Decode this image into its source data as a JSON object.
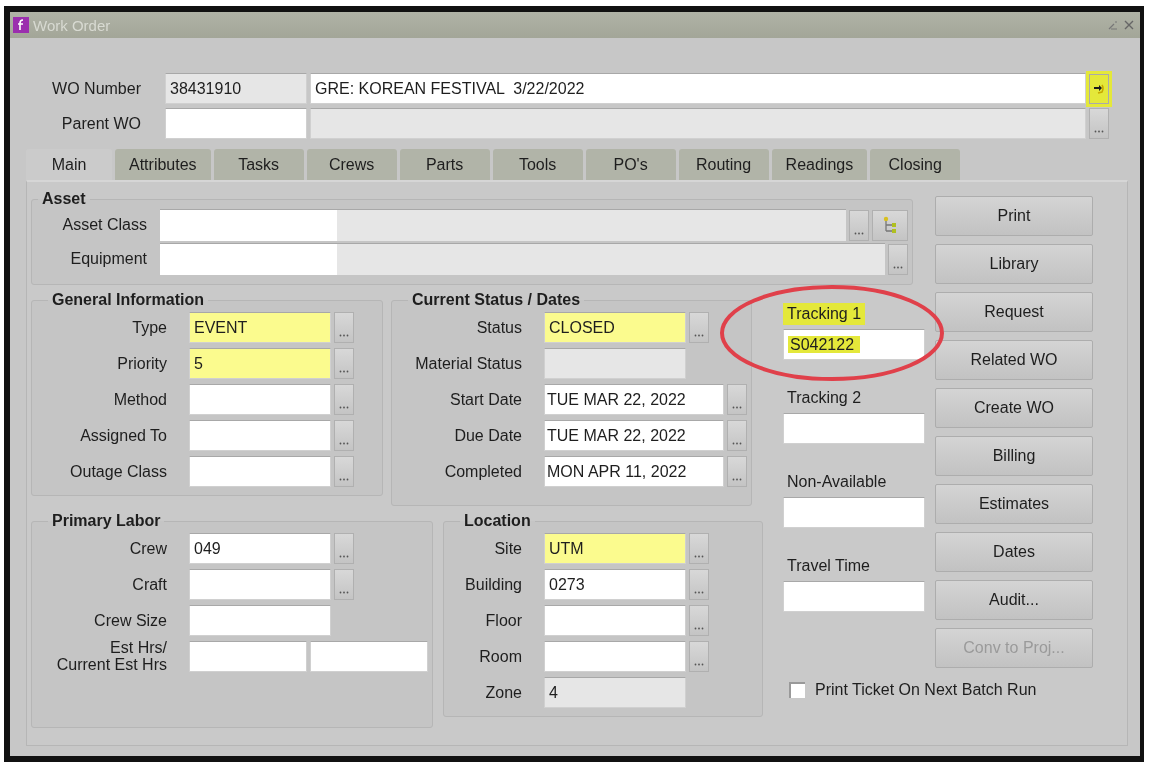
{
  "window": {
    "title": "Work Order"
  },
  "header": {
    "rows": [
      {
        "label": "WO Number",
        "value": "38431910",
        "description": "GRE: KOREAN FESTIVAL  3/22/2022",
        "kind": "go"
      },
      {
        "label": "Parent WO",
        "kind": "lookup"
      }
    ],
    "go_highlighted": true
  },
  "tabs": [
    {
      "label": "Main",
      "selected": true
    },
    {
      "label": "Attributes",
      "selected": false
    },
    {
      "label": "Tasks",
      "selected": false
    },
    {
      "label": "Crews",
      "selected": false
    },
    {
      "label": "Parts",
      "selected": false
    },
    {
      "label": "Tools",
      "selected": false
    },
    {
      "label": "PO's",
      "selected": false
    },
    {
      "label": "Routing",
      "selected": false
    },
    {
      "label": "Readings",
      "selected": false
    },
    {
      "label": "Closing",
      "selected": false
    }
  ],
  "asset": {
    "title": "Asset",
    "rows": [
      {
        "label": "Asset Class",
        "tree_button": true
      },
      {
        "label": "Equipment",
        "tree_button": false
      }
    ]
  },
  "general": {
    "title": "General Information",
    "fields": [
      {
        "label": "Type",
        "value": "EVENT",
        "kind": "text",
        "required": true,
        "readonly": false,
        "lookup": true
      },
      {
        "label": "Priority",
        "value": "5",
        "kind": "text",
        "required": true,
        "readonly": false,
        "lookup": true
      },
      {
        "label": "Method",
        "kind": "text",
        "required": false,
        "readonly": false,
        "lookup": true
      },
      {
        "label": "Assigned To",
        "kind": "text",
        "required": false,
        "readonly": false,
        "lookup": true
      },
      {
        "label": "Outage Class",
        "kind": "text",
        "required": false,
        "readonly": false,
        "lookup": true
      }
    ]
  },
  "status": {
    "title": "Current Status / Dates",
    "fields": [
      {
        "label": "Status",
        "value": "CLOSED",
        "kind": "text",
        "required": true,
        "readonly": false,
        "lookup": true
      },
      {
        "label": "Material Status",
        "kind": "text",
        "required": false,
        "readonly": true,
        "lookup": false
      },
      {
        "label": "Start Date",
        "value": "TUE MAR 22, 2022",
        "kind": "date",
        "required": false,
        "readonly": false,
        "lookup": true
      },
      {
        "label": "Due Date",
        "value": "TUE MAR 22, 2022",
        "kind": "date",
        "required": false,
        "readonly": false,
        "lookup": true
      },
      {
        "label": "Completed",
        "value": "MON APR 11, 2022",
        "kind": "date",
        "required": false,
        "readonly": false,
        "lookup": true
      }
    ]
  },
  "labor": {
    "title": "Primary Labor",
    "fields": [
      {
        "label": "Crew",
        "value": "049",
        "kind": "text",
        "required": false,
        "readonly": false,
        "lookup": true
      },
      {
        "label": "Craft",
        "kind": "text",
        "required": false,
        "readonly": false,
        "lookup": true
      },
      {
        "label": "Crew Size",
        "kind": "text",
        "required": false,
        "readonly": false,
        "lookup": false
      },
      {
        "label": "Est Hrs/\nCurrent Est Hrs",
        "kind": "pair",
        "required": false,
        "readonly": false,
        "lookup": false
      }
    ]
  },
  "location": {
    "title": "Location",
    "fields": [
      {
        "label": "Site",
        "value": "UTM",
        "kind": "text",
        "required": true,
        "readonly": false,
        "lookup": true
      },
      {
        "label": "Building",
        "value": "0273",
        "kind": "text",
        "required": false,
        "readonly": false,
        "lookup": true
      },
      {
        "label": "Floor",
        "kind": "text",
        "required": false,
        "readonly": false,
        "lookup": true
      },
      {
        "label": "Room",
        "kind": "text",
        "required": false,
        "readonly": false,
        "lookup": true
      },
      {
        "label": "Zone",
        "value": "4",
        "kind": "text",
        "required": false,
        "readonly": true,
        "lookup": false
      }
    ]
  },
  "tracking": [
    {
      "label": "Tracking 1",
      "value": "S042122",
      "highlighted": true,
      "circled": true
    },
    {
      "label": "Tracking 2",
      "highlighted": false,
      "circled": false
    },
    {
      "label": "Non-Available",
      "highlighted": false,
      "circled": false
    },
    {
      "label": "Travel Time",
      "highlighted": false,
      "circled": false
    }
  ],
  "buttons": [
    {
      "label": "Print",
      "disabled": false
    },
    {
      "label": "Library",
      "disabled": false
    },
    {
      "label": "Request",
      "disabled": false
    },
    {
      "label": "Related WO",
      "disabled": false
    },
    {
      "label": "Create WO",
      "disabled": false
    },
    {
      "label": "Billing",
      "disabled": false
    },
    {
      "label": "Estimates",
      "disabled": false
    },
    {
      "label": "Dates",
      "disabled": false
    },
    {
      "label": "Audit...",
      "disabled": false
    },
    {
      "label": "Conv to Proj...",
      "disabled": true
    }
  ],
  "print_ticket": {
    "label": "Print Ticket On Next Batch Run",
    "checked": false
  }
}
